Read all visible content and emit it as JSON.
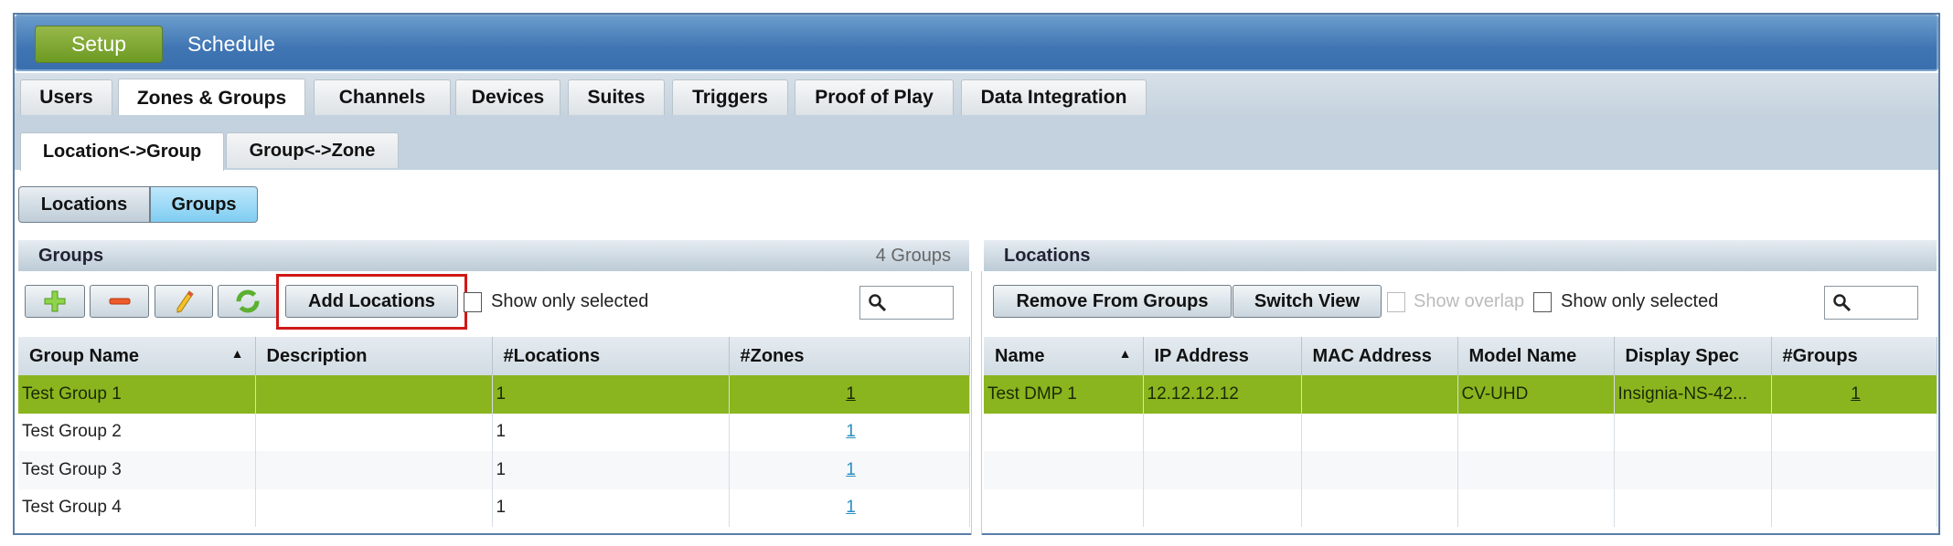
{
  "topnav": {
    "items": [
      "Setup",
      "Schedule"
    ],
    "active": "Setup"
  },
  "tabs": [
    "Users",
    "Zones & Groups",
    "Channels",
    "Devices",
    "Suites",
    "Triggers",
    "Proof of Play",
    "Data Integration"
  ],
  "subtabs": [
    "Location<->Group",
    "Group<->Zone"
  ],
  "view_toggle": [
    "Locations",
    "Groups"
  ],
  "groups_panel": {
    "title": "Groups",
    "count": "4 Groups",
    "add_locations": "Add Locations",
    "show_only_selected": "Show only selected",
    "columns": [
      "Group Name",
      "Description",
      "#Locations",
      "#Zones"
    ],
    "rows": [
      {
        "name": "Test Group 1",
        "description": "",
        "locations": "1",
        "zones": "1"
      },
      {
        "name": "Test Group 2",
        "description": "",
        "locations": "1",
        "zones": "1"
      },
      {
        "name": "Test Group 3",
        "description": "",
        "locations": "1",
        "zones": "1"
      },
      {
        "name": "Test Group 4",
        "description": "",
        "locations": "1",
        "zones": "1"
      }
    ]
  },
  "locations_panel": {
    "title": "Locations",
    "remove_from_groups": "Remove From Groups",
    "switch_view": "Switch View",
    "show_overlap": "Show overlap",
    "show_only_selected": "Show only selected",
    "columns": [
      "Name",
      "IP Address",
      "MAC Address",
      "Model Name",
      "Display Spec",
      "#Groups"
    ],
    "rows": [
      {
        "name": "Test DMP 1",
        "ip": "12.12.12.12",
        "mac": "",
        "model": "CV-UHD",
        "display": "Insignia-NS-42...",
        "groups": "1"
      }
    ]
  },
  "colors": {
    "accent_green": "#8ab51f",
    "header_blue": "#3f75b3",
    "highlight": "#d01818"
  }
}
